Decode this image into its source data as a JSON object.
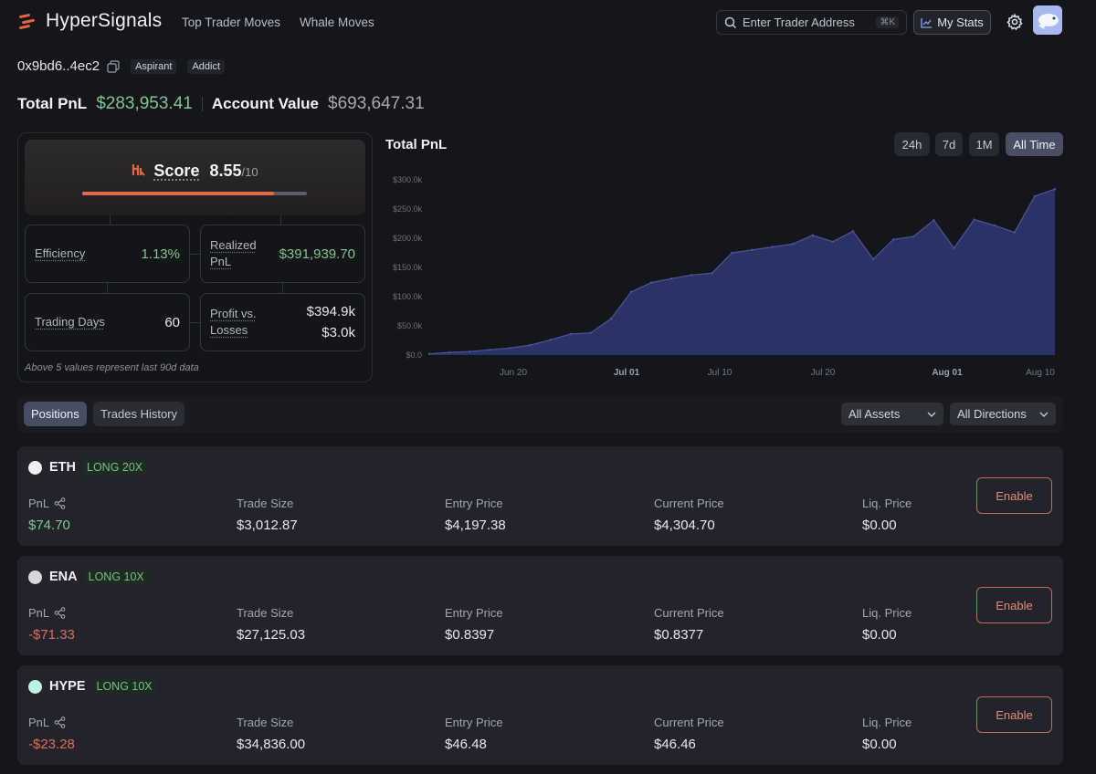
{
  "app": {
    "name": "HyperSignals",
    "nav": [
      "Top Trader Moves",
      "Whale Moves"
    ],
    "search_placeholder": "Enter Trader Address",
    "search_shortcut": "⌘K",
    "my_stats": "My Stats"
  },
  "trader": {
    "address": "0x9bd6..4ec2",
    "badges": [
      "Aspirant",
      "Addict"
    ],
    "total_pnl_label": "Total PnL",
    "total_pnl": "$283,953.41",
    "account_value_label": "Account Value",
    "account_value": "$693,647.31"
  },
  "score": {
    "label": "Score",
    "value": "8.55",
    "denominator": "/10",
    "fraction": 0.855,
    "efficiency_label": "Efficiency",
    "efficiency": "1.13%",
    "realized_label_1": "Realized",
    "realized_label_2": "PnL",
    "realized": "$391,939.70",
    "days_label": "Trading Days",
    "days": "60",
    "pvl_label_1": "Profit vs.",
    "pvl_label_2": "Losses",
    "profit": "$394.9k",
    "losses": "$3.0k",
    "footnote": "Above 5 values represent last 90d data"
  },
  "chart": {
    "title": "Total PnL",
    "ranges": [
      "24h",
      "7d",
      "1M",
      "All Time"
    ],
    "active_range": "All Time"
  },
  "chart_data": {
    "type": "area",
    "title": "Total PnL",
    "ylim": [
      0,
      300000
    ],
    "y_ticks": [
      "$0.0",
      "$50.0k",
      "$100.0k",
      "$150.0k",
      "$200.0k",
      "$250.0k",
      "$300.0k"
    ],
    "x_ticks": [
      "Jun 20",
      "Jul 01",
      "Jul 10",
      "Jul 20",
      "Aug 01",
      "Aug 10"
    ],
    "color": "#2b3366",
    "series": [
      {
        "x": [
          "Jun 12",
          "Jun 14",
          "Jun 16",
          "Jun 18",
          "Jun 20",
          "Jun 22",
          "Jun 24",
          "Jun 26",
          "Jun 28",
          "Jun 30",
          "Jul 01",
          "Jul 03",
          "Jul 05",
          "Jul 07",
          "Jul 09",
          "Jul 11",
          "Jul 13",
          "Jul 15",
          "Jul 17",
          "Jul 19",
          "Jul 21",
          "Jul 23",
          "Jul 25",
          "Jul 27",
          "Jul 29",
          "Jul 31",
          "Aug 01",
          "Aug 03",
          "Aug 05",
          "Aug 07",
          "Aug 09",
          "Aug 11"
        ],
        "values": [
          2000,
          4500,
          6000,
          9000,
          12000,
          17000,
          26000,
          36000,
          38000,
          62000,
          108000,
          124000,
          131000,
          137000,
          140000,
          175000,
          180000,
          185000,
          190000,
          205000,
          194000,
          212000,
          164000,
          198000,
          203000,
          231000,
          183000,
          232000,
          222000,
          210000,
          272000,
          284000
        ]
      }
    ]
  },
  "tabs": [
    "Positions",
    "Trades History"
  ],
  "filters": [
    "All Assets",
    "All Directions"
  ],
  "columns": [
    "PnL",
    "Trade Size",
    "Entry Price",
    "Current Price",
    "Liq. Price"
  ],
  "enable_label": "Enable",
  "positions": [
    {
      "asset": "ETH",
      "side": "LONG 20X",
      "coin_color": "#f0f1f4",
      "pnl": "$74.70",
      "pnl_sign": "pos",
      "size": "$3,012.87",
      "entry": "$4,197.38",
      "current": "$4,304.70",
      "liq": "$0.00"
    },
    {
      "asset": "ENA",
      "side": "LONG 10X",
      "coin_color": "#d7d8dc",
      "pnl": "-$71.33",
      "pnl_sign": "neg",
      "size": "$27,125.03",
      "entry": "$0.8397",
      "current": "$0.8377",
      "liq": "$0.00"
    },
    {
      "asset": "HYPE",
      "side": "LONG 10X",
      "coin_color": "#bff3e4",
      "pnl": "-$23.28",
      "pnl_sign": "neg",
      "size": "$34,836.00",
      "entry": "$46.48",
      "current": "$46.46",
      "liq": "$0.00"
    }
  ]
}
